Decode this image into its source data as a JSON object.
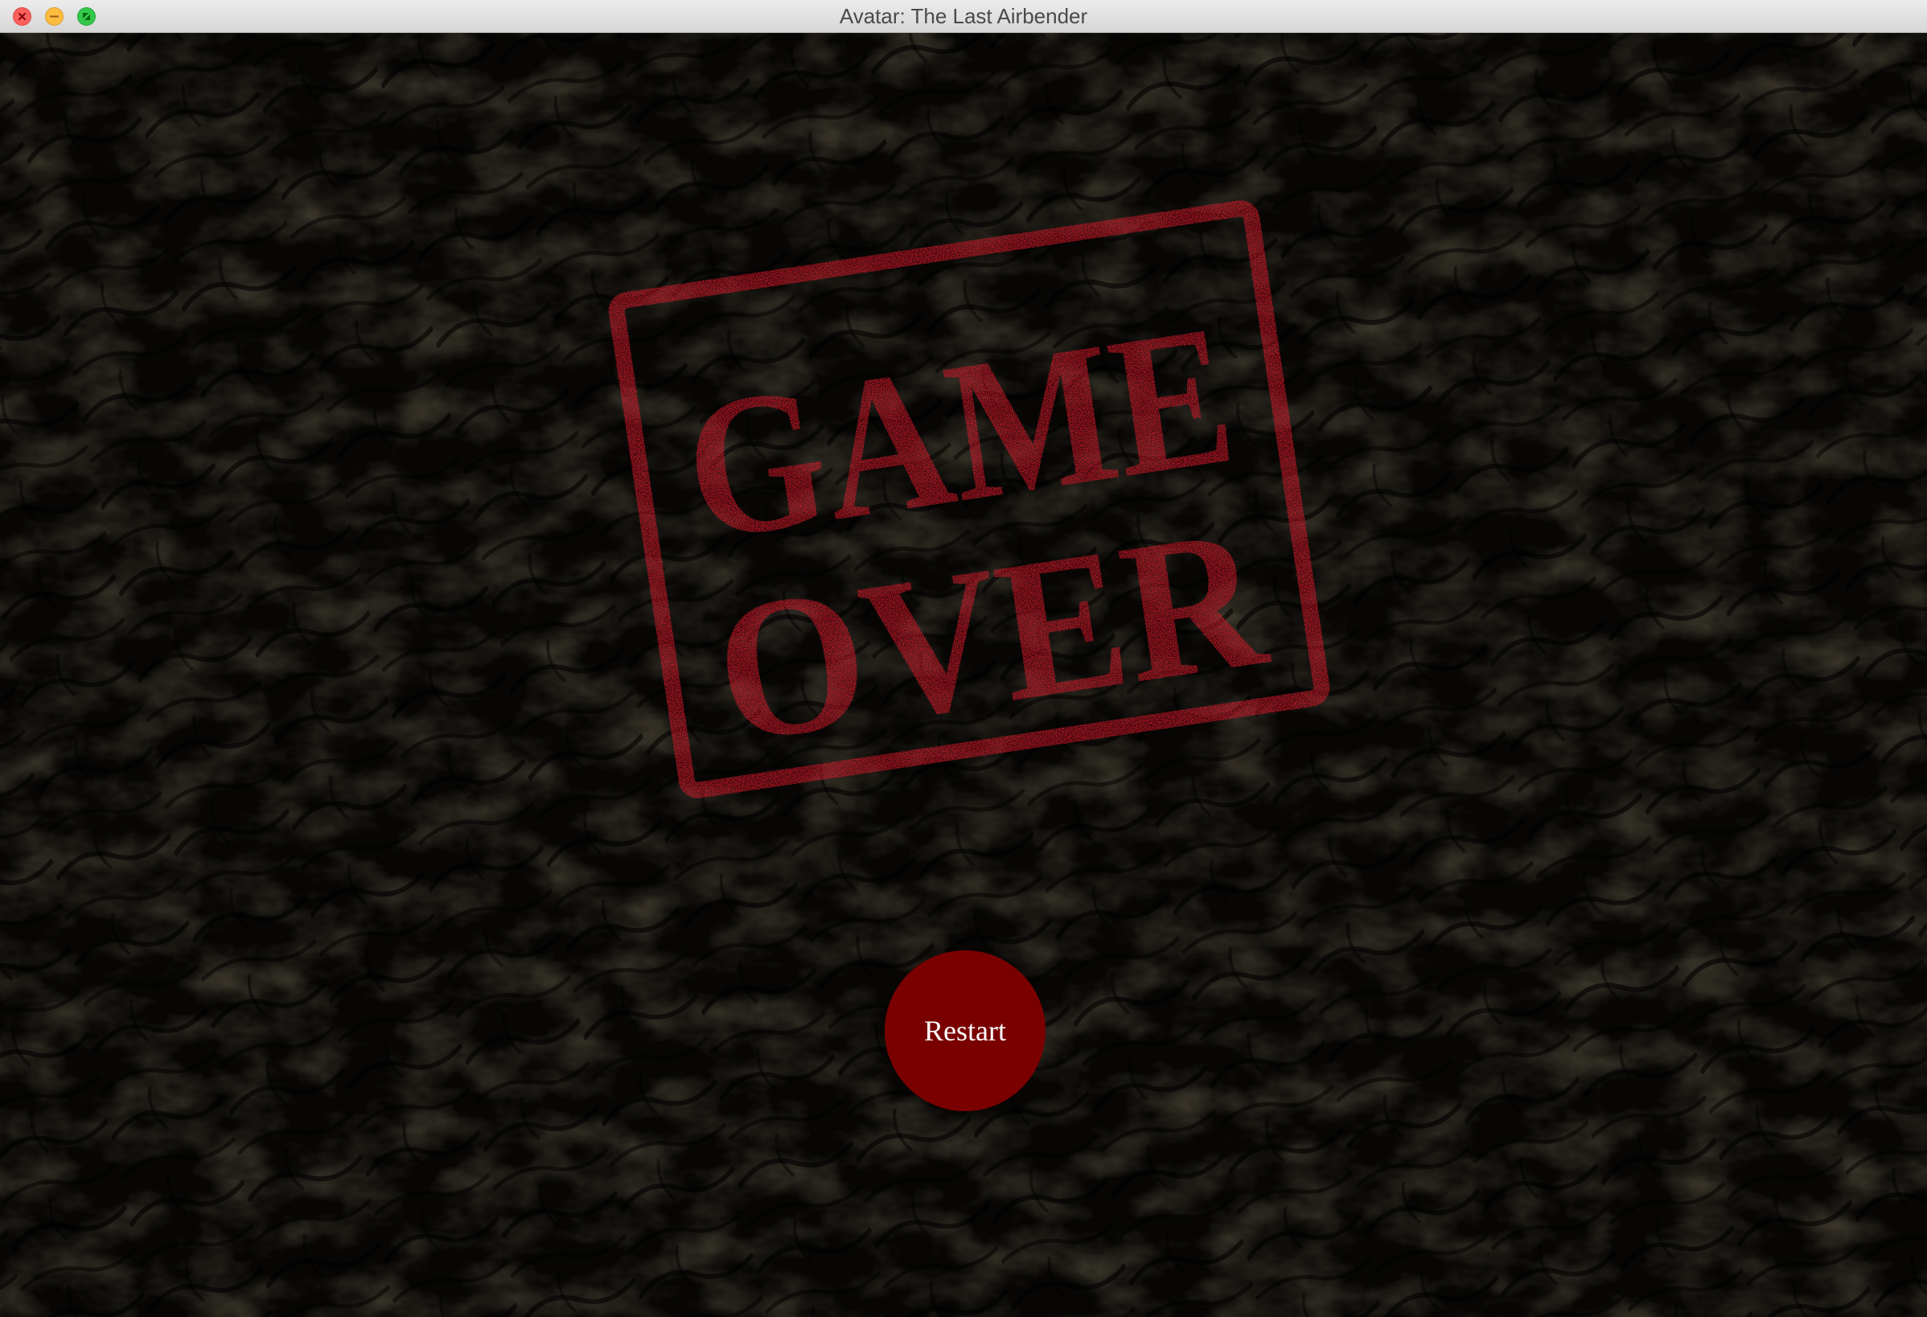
{
  "window": {
    "title": "Avatar: The Last Airbender",
    "controls": [
      "close",
      "minimize",
      "zoom"
    ]
  },
  "game_over": {
    "stamp_line1": "GAME",
    "stamp_line2": "OVER",
    "stamp_color": "#e8192c"
  },
  "restart": {
    "label": "Restart",
    "color": "#7a0000"
  },
  "background": {
    "color": "#060503",
    "pattern": "dark rocky texture"
  }
}
